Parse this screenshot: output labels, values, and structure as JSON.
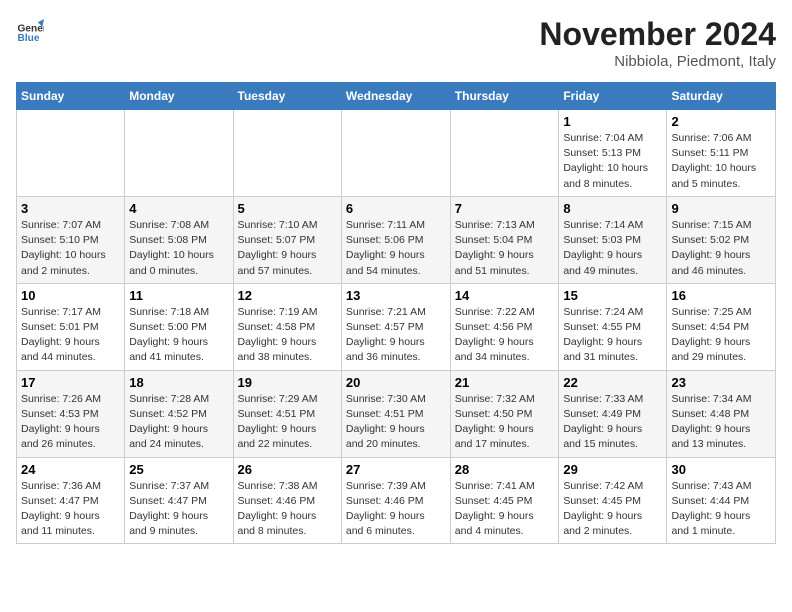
{
  "header": {
    "logo_line1": "General",
    "logo_line2": "Blue",
    "month_title": "November 2024",
    "location": "Nibbiola, Piedmont, Italy"
  },
  "weekdays": [
    "Sunday",
    "Monday",
    "Tuesday",
    "Wednesday",
    "Thursday",
    "Friday",
    "Saturday"
  ],
  "weeks": [
    [
      {
        "day": "",
        "info": ""
      },
      {
        "day": "",
        "info": ""
      },
      {
        "day": "",
        "info": ""
      },
      {
        "day": "",
        "info": ""
      },
      {
        "day": "",
        "info": ""
      },
      {
        "day": "1",
        "info": "Sunrise: 7:04 AM\nSunset: 5:13 PM\nDaylight: 10 hours\nand 8 minutes."
      },
      {
        "day": "2",
        "info": "Sunrise: 7:06 AM\nSunset: 5:11 PM\nDaylight: 10 hours\nand 5 minutes."
      }
    ],
    [
      {
        "day": "3",
        "info": "Sunrise: 7:07 AM\nSunset: 5:10 PM\nDaylight: 10 hours\nand 2 minutes."
      },
      {
        "day": "4",
        "info": "Sunrise: 7:08 AM\nSunset: 5:08 PM\nDaylight: 10 hours\nand 0 minutes."
      },
      {
        "day": "5",
        "info": "Sunrise: 7:10 AM\nSunset: 5:07 PM\nDaylight: 9 hours\nand 57 minutes."
      },
      {
        "day": "6",
        "info": "Sunrise: 7:11 AM\nSunset: 5:06 PM\nDaylight: 9 hours\nand 54 minutes."
      },
      {
        "day": "7",
        "info": "Sunrise: 7:13 AM\nSunset: 5:04 PM\nDaylight: 9 hours\nand 51 minutes."
      },
      {
        "day": "8",
        "info": "Sunrise: 7:14 AM\nSunset: 5:03 PM\nDaylight: 9 hours\nand 49 minutes."
      },
      {
        "day": "9",
        "info": "Sunrise: 7:15 AM\nSunset: 5:02 PM\nDaylight: 9 hours\nand 46 minutes."
      }
    ],
    [
      {
        "day": "10",
        "info": "Sunrise: 7:17 AM\nSunset: 5:01 PM\nDaylight: 9 hours\nand 44 minutes."
      },
      {
        "day": "11",
        "info": "Sunrise: 7:18 AM\nSunset: 5:00 PM\nDaylight: 9 hours\nand 41 minutes."
      },
      {
        "day": "12",
        "info": "Sunrise: 7:19 AM\nSunset: 4:58 PM\nDaylight: 9 hours\nand 38 minutes."
      },
      {
        "day": "13",
        "info": "Sunrise: 7:21 AM\nSunset: 4:57 PM\nDaylight: 9 hours\nand 36 minutes."
      },
      {
        "day": "14",
        "info": "Sunrise: 7:22 AM\nSunset: 4:56 PM\nDaylight: 9 hours\nand 34 minutes."
      },
      {
        "day": "15",
        "info": "Sunrise: 7:24 AM\nSunset: 4:55 PM\nDaylight: 9 hours\nand 31 minutes."
      },
      {
        "day": "16",
        "info": "Sunrise: 7:25 AM\nSunset: 4:54 PM\nDaylight: 9 hours\nand 29 minutes."
      }
    ],
    [
      {
        "day": "17",
        "info": "Sunrise: 7:26 AM\nSunset: 4:53 PM\nDaylight: 9 hours\nand 26 minutes."
      },
      {
        "day": "18",
        "info": "Sunrise: 7:28 AM\nSunset: 4:52 PM\nDaylight: 9 hours\nand 24 minutes."
      },
      {
        "day": "19",
        "info": "Sunrise: 7:29 AM\nSunset: 4:51 PM\nDaylight: 9 hours\nand 22 minutes."
      },
      {
        "day": "20",
        "info": "Sunrise: 7:30 AM\nSunset: 4:51 PM\nDaylight: 9 hours\nand 20 minutes."
      },
      {
        "day": "21",
        "info": "Sunrise: 7:32 AM\nSunset: 4:50 PM\nDaylight: 9 hours\nand 17 minutes."
      },
      {
        "day": "22",
        "info": "Sunrise: 7:33 AM\nSunset: 4:49 PM\nDaylight: 9 hours\nand 15 minutes."
      },
      {
        "day": "23",
        "info": "Sunrise: 7:34 AM\nSunset: 4:48 PM\nDaylight: 9 hours\nand 13 minutes."
      }
    ],
    [
      {
        "day": "24",
        "info": "Sunrise: 7:36 AM\nSunset: 4:47 PM\nDaylight: 9 hours\nand 11 minutes."
      },
      {
        "day": "25",
        "info": "Sunrise: 7:37 AM\nSunset: 4:47 PM\nDaylight: 9 hours\nand 9 minutes."
      },
      {
        "day": "26",
        "info": "Sunrise: 7:38 AM\nSunset: 4:46 PM\nDaylight: 9 hours\nand 8 minutes."
      },
      {
        "day": "27",
        "info": "Sunrise: 7:39 AM\nSunset: 4:46 PM\nDaylight: 9 hours\nand 6 minutes."
      },
      {
        "day": "28",
        "info": "Sunrise: 7:41 AM\nSunset: 4:45 PM\nDaylight: 9 hours\nand 4 minutes."
      },
      {
        "day": "29",
        "info": "Sunrise: 7:42 AM\nSunset: 4:45 PM\nDaylight: 9 hours\nand 2 minutes."
      },
      {
        "day": "30",
        "info": "Sunrise: 7:43 AM\nSunset: 4:44 PM\nDaylight: 9 hours\nand 1 minute."
      }
    ]
  ]
}
